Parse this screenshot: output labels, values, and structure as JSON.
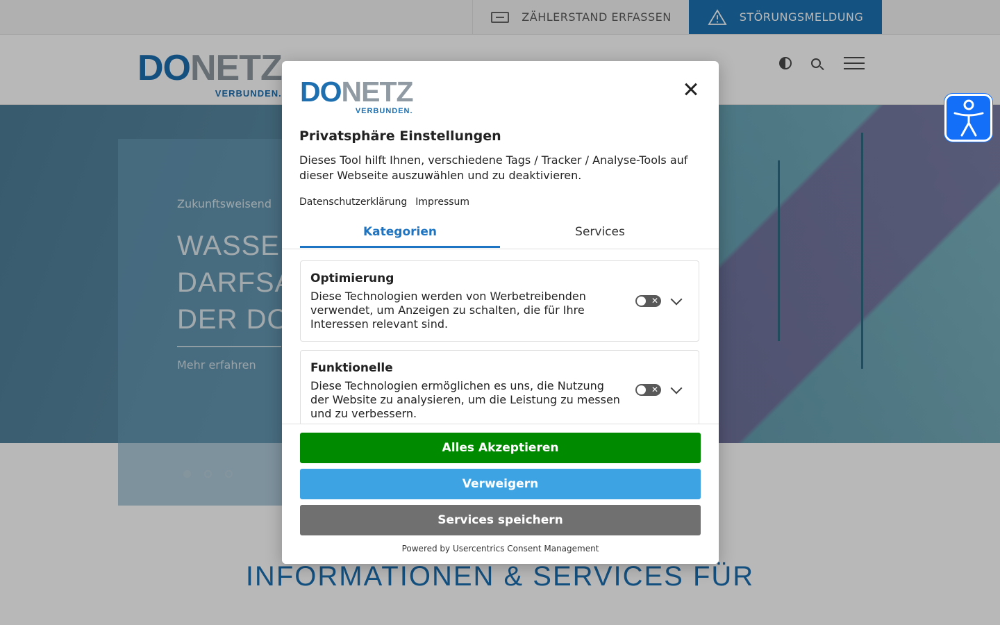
{
  "topbar": {
    "meter_reading": "ZÄHLERSTAND ERFASSEN",
    "fault_report": "STÖRUNGSMELDUNG"
  },
  "brand": {
    "logo_do": "DO",
    "logo_netz": "NETZ",
    "tagline": "VERBUNDEN."
  },
  "hero": {
    "eyebrow": "Zukunftsweisend",
    "title_lines": [
      "WASSER",
      "DARFSA",
      "DER DO"
    ],
    "more_link": "Mehr erfahren",
    "slides": 3,
    "active_slide": 1
  },
  "section": {
    "title": "INFORMATIONEN & SERVICES FÜR"
  },
  "consent": {
    "title": "Privatsphäre Einstellungen",
    "description": "Dieses Tool hilft Ihnen, verschiedene Tags / Tracker / Analyse-Tools auf dieser Webseite auszuwählen und zu deaktivieren.",
    "links": {
      "privacy": "Datenschutzerklärung",
      "imprint": "Impressum"
    },
    "tabs": {
      "categories": "Kategorien",
      "services": "Services",
      "active": "Kategorien"
    },
    "categories": [
      {
        "name": "Optimierung",
        "description": "Diese Technologien werden von Werbetreibenden verwendet, um Anzeigen zu schalten, die für Ihre Interessen relevant sind.",
        "enabled": false
      },
      {
        "name": "Funktionelle",
        "description": "Diese Technologien ermöglichen es uns, die Nutzung der Website zu analysieren, um die Leistung zu messen und zu verbessern.",
        "enabled": false
      }
    ],
    "buttons": {
      "accept_all": "Alles Akzeptieren",
      "deny": "Verweigern",
      "save": "Services speichern"
    },
    "powered_by": "Powered by Usercentrics Consent Management"
  },
  "colors": {
    "brand_blue": "#1d6fb0",
    "accept_green": "#008a00",
    "deny_blue": "#3ea3e3",
    "save_gray": "#707070"
  }
}
